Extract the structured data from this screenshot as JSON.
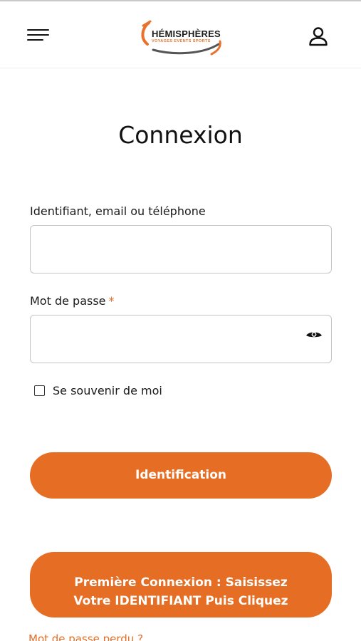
{
  "header": {
    "menu_icon": "hamburger-menu-icon",
    "logo": {
      "brand": "HÉMISPHÈRES",
      "tagline": "VOYAGES EVENTS SPORTS",
      "accent_color": "#e8722a"
    },
    "user_icon": "user-account-icon"
  },
  "login_form": {
    "title": "Connexion",
    "identifier": {
      "label": "Identifiant, email ou téléphone",
      "value": "",
      "placeholder": ""
    },
    "password": {
      "label": "Mot de passe",
      "required_marker": "*",
      "value": "",
      "placeholder": "",
      "toggle_icon": "eye-icon"
    },
    "remember_me": {
      "label": "Se souvenir de moi",
      "checked": false
    },
    "submit_label": "Identification",
    "first_login": {
      "line1": "Première Connexion : Saisissez",
      "line2": "Votre IDENTIFIANT Puis Cliquez"
    },
    "forgot_password": "Mot de passe perdu ?"
  },
  "colors": {
    "accent": "#e56d24",
    "field_border": "#c4c4c4",
    "text": "#1a1a1a"
  }
}
